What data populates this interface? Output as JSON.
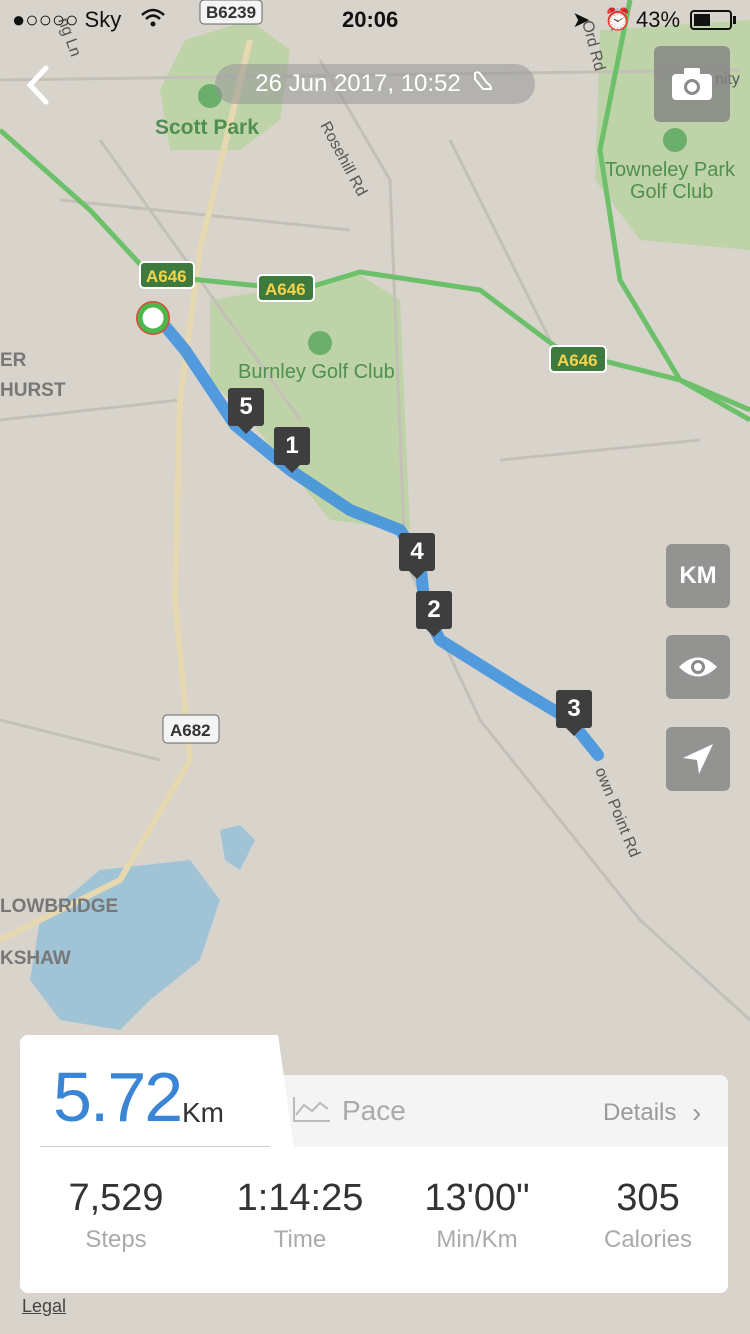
{
  "status": {
    "carrier": "●○○○○ Sky",
    "time": "20:06",
    "battery": "43%"
  },
  "header": {
    "date": "26 Jun 2017, 10:52",
    "back_icon": "chevron-left-icon",
    "camera_icon": "camera-icon",
    "activity_icon": "shoe-icon"
  },
  "map_labels": {
    "b6239": "B6239",
    "scott_park": "Scott Park",
    "rosehill": "Rosehill Rd",
    "towneley": "Towneley Park",
    "golf_club": "Golf Club",
    "a646_1": "A646",
    "a646_2": "A646",
    "a646_3": "A646",
    "burnley": "Burnley Golf Club",
    "er": "ER",
    "hurst": "HURST",
    "a682": "A682",
    "lowbridge": "LOWBRIDGE",
    "kshaw": "KSHAW",
    "town_point": "own Point Rd",
    "ord_rd": "Ord Rd",
    "nity": "nity",
    "lane": "ng Ln"
  },
  "markers": [
    "1",
    "2",
    "3",
    "4",
    "5"
  ],
  "controls": {
    "unit": "KM",
    "eye_icon": "eye-icon",
    "locate_icon": "navigation-arrow-icon"
  },
  "summary": {
    "distance": "5.72",
    "distance_unit": "Km",
    "pace_tab": "Pace",
    "details": "Details",
    "stats": [
      {
        "value": "7,529",
        "label": "Steps"
      },
      {
        "value": "1:14:25",
        "label": "Time"
      },
      {
        "value": "13'00\"",
        "label": "Min/Km"
      },
      {
        "value": "305",
        "label": "Calories"
      }
    ]
  },
  "legal": "Legal",
  "colors": {
    "route": "#3a8fe0",
    "road_green": "#6cc06a",
    "park": "#b9d3a6",
    "water": "#9cc4da",
    "accent": "#3a85d6"
  }
}
